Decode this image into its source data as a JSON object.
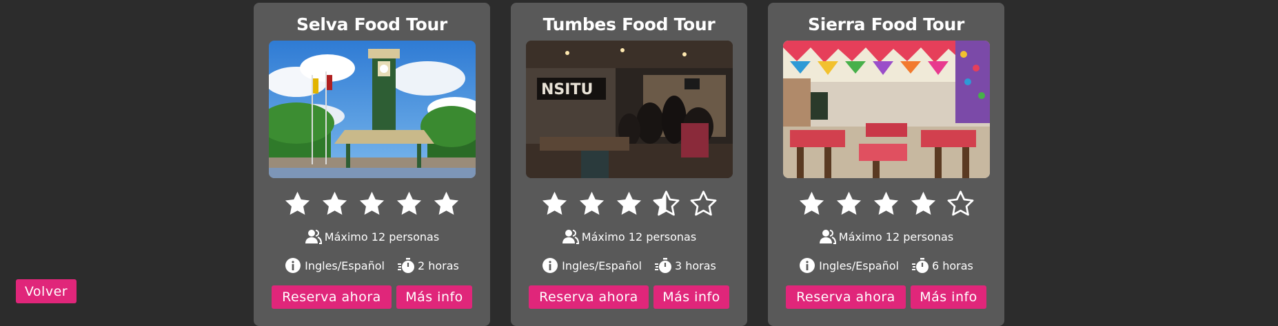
{
  "back_button": {
    "label": "Volver"
  },
  "colors": {
    "background": "#2c2c2c",
    "card": "#595959",
    "accent": "#e0267a",
    "text": "#ffffff"
  },
  "tours": [
    {
      "title": "Selva Food Tour",
      "photo": "town-square-clock-tower",
      "rating": 5,
      "capacity_icon": "users-icon",
      "capacity": "Máximo 12 personas",
      "language_icon": "info-icon",
      "language": "Ingles/Español",
      "duration_icon": "stopwatch-icon",
      "duration": "2 horas",
      "reserve_label": "Reserva ahora",
      "more_label": "Más info"
    },
    {
      "title": "Tumbes Food Tour",
      "photo": "restaurant-bar-interior",
      "rating": 3.5,
      "capacity_icon": "users-icon",
      "capacity": "Máximo 12 personas",
      "language_icon": "info-icon",
      "language": "Ingles/Español",
      "duration_icon": "stopwatch-icon",
      "duration": "3 horas",
      "reserve_label": "Reserva ahora",
      "more_label": "Más info"
    },
    {
      "title": "Sierra Food Tour",
      "photo": "colorful-dining-hall",
      "rating": 4,
      "capacity_icon": "users-icon",
      "capacity": "Máximo 12 personas",
      "language_icon": "info-icon",
      "language": "Ingles/Español",
      "duration_icon": "stopwatch-icon",
      "duration": "6 horas",
      "reserve_label": "Reserva ahora",
      "more_label": "Más info"
    }
  ]
}
